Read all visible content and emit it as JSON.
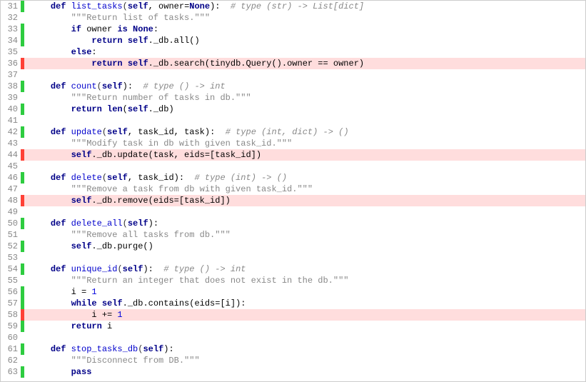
{
  "lines": [
    {
      "n": 31,
      "cov": "hit",
      "code": {
        "segs": [
          {
            "t": "    ",
            "c": ""
          },
          {
            "t": "def",
            "c": "kw"
          },
          {
            "t": " ",
            "c": ""
          },
          {
            "t": "list_tasks",
            "c": "fn"
          },
          {
            "t": "(",
            "c": "op"
          },
          {
            "t": "self",
            "c": "builtin"
          },
          {
            "t": ", owner=",
            "c": ""
          },
          {
            "t": "None",
            "c": "builtin"
          },
          {
            "t": "):  ",
            "c": ""
          },
          {
            "t": "# type (str) -> List[dict]",
            "c": "comment"
          }
        ]
      }
    },
    {
      "n": 32,
      "cov": "",
      "code": {
        "segs": [
          {
            "t": "        ",
            "c": ""
          },
          {
            "t": "\"\"\"Return list of tasks.\"\"\"",
            "c": "str"
          }
        ]
      }
    },
    {
      "n": 33,
      "cov": "hit",
      "code": {
        "segs": [
          {
            "t": "        ",
            "c": ""
          },
          {
            "t": "if",
            "c": "kw"
          },
          {
            "t": " owner ",
            "c": ""
          },
          {
            "t": "is",
            "c": "kw"
          },
          {
            "t": " ",
            "c": ""
          },
          {
            "t": "None",
            "c": "builtin"
          },
          {
            "t": ":",
            "c": ""
          }
        ]
      }
    },
    {
      "n": 34,
      "cov": "hit",
      "code": {
        "segs": [
          {
            "t": "            ",
            "c": ""
          },
          {
            "t": "return",
            "c": "kw"
          },
          {
            "t": " ",
            "c": ""
          },
          {
            "t": "self",
            "c": "builtin"
          },
          {
            "t": "._db.all()",
            "c": ""
          }
        ]
      }
    },
    {
      "n": 35,
      "cov": "",
      "code": {
        "segs": [
          {
            "t": "        ",
            "c": ""
          },
          {
            "t": "else",
            "c": "kw"
          },
          {
            "t": ":",
            "c": ""
          }
        ]
      }
    },
    {
      "n": 36,
      "cov": "miss",
      "code": {
        "segs": [
          {
            "t": "            ",
            "c": ""
          },
          {
            "t": "return",
            "c": "kw"
          },
          {
            "t": " ",
            "c": ""
          },
          {
            "t": "self",
            "c": "builtin"
          },
          {
            "t": "._db.search(tinydb.Query().owner == owner)",
            "c": ""
          }
        ]
      }
    },
    {
      "n": 37,
      "cov": "",
      "code": {
        "segs": [
          {
            "t": "",
            "c": ""
          }
        ]
      }
    },
    {
      "n": 38,
      "cov": "hit",
      "code": {
        "segs": [
          {
            "t": "    ",
            "c": ""
          },
          {
            "t": "def",
            "c": "kw"
          },
          {
            "t": " ",
            "c": ""
          },
          {
            "t": "count",
            "c": "fn"
          },
          {
            "t": "(",
            "c": "op"
          },
          {
            "t": "self",
            "c": "builtin"
          },
          {
            "t": "):  ",
            "c": ""
          },
          {
            "t": "# type () -> int",
            "c": "comment"
          }
        ]
      }
    },
    {
      "n": 39,
      "cov": "",
      "code": {
        "segs": [
          {
            "t": "        ",
            "c": ""
          },
          {
            "t": "\"\"\"Return number of tasks in db.\"\"\"",
            "c": "str"
          }
        ]
      }
    },
    {
      "n": 40,
      "cov": "hit",
      "code": {
        "segs": [
          {
            "t": "        ",
            "c": ""
          },
          {
            "t": "return",
            "c": "kw"
          },
          {
            "t": " ",
            "c": ""
          },
          {
            "t": "len",
            "c": "builtin"
          },
          {
            "t": "(",
            "c": ""
          },
          {
            "t": "self",
            "c": "builtin"
          },
          {
            "t": "._db)",
            "c": ""
          }
        ]
      }
    },
    {
      "n": 41,
      "cov": "",
      "code": {
        "segs": [
          {
            "t": "",
            "c": ""
          }
        ]
      }
    },
    {
      "n": 42,
      "cov": "hit",
      "code": {
        "segs": [
          {
            "t": "    ",
            "c": ""
          },
          {
            "t": "def",
            "c": "kw"
          },
          {
            "t": " ",
            "c": ""
          },
          {
            "t": "update",
            "c": "fn"
          },
          {
            "t": "(",
            "c": "op"
          },
          {
            "t": "self",
            "c": "builtin"
          },
          {
            "t": ", task_id, task):  ",
            "c": ""
          },
          {
            "t": "# type (int, dict) -> ()",
            "c": "comment"
          }
        ]
      }
    },
    {
      "n": 43,
      "cov": "",
      "code": {
        "segs": [
          {
            "t": "        ",
            "c": ""
          },
          {
            "t": "\"\"\"Modify task in db with given task_id.\"\"\"",
            "c": "str"
          }
        ]
      }
    },
    {
      "n": 44,
      "cov": "miss",
      "code": {
        "segs": [
          {
            "t": "        ",
            "c": ""
          },
          {
            "t": "self",
            "c": "builtin"
          },
          {
            "t": "._db.update(task, eids=[task_id])",
            "c": ""
          }
        ]
      }
    },
    {
      "n": 45,
      "cov": "",
      "code": {
        "segs": [
          {
            "t": "",
            "c": ""
          }
        ]
      }
    },
    {
      "n": 46,
      "cov": "hit",
      "code": {
        "segs": [
          {
            "t": "    ",
            "c": ""
          },
          {
            "t": "def",
            "c": "kw"
          },
          {
            "t": " ",
            "c": ""
          },
          {
            "t": "delete",
            "c": "fn"
          },
          {
            "t": "(",
            "c": "op"
          },
          {
            "t": "self",
            "c": "builtin"
          },
          {
            "t": ", task_id):  ",
            "c": ""
          },
          {
            "t": "# type (int) -> ()",
            "c": "comment"
          }
        ]
      }
    },
    {
      "n": 47,
      "cov": "",
      "code": {
        "segs": [
          {
            "t": "        ",
            "c": ""
          },
          {
            "t": "\"\"\"Remove a task from db with given task_id.\"\"\"",
            "c": "str"
          }
        ]
      }
    },
    {
      "n": 48,
      "cov": "miss",
      "code": {
        "segs": [
          {
            "t": "        ",
            "c": ""
          },
          {
            "t": "self",
            "c": "builtin"
          },
          {
            "t": "._db.remove(eids=[task_id])",
            "c": ""
          }
        ]
      }
    },
    {
      "n": 49,
      "cov": "",
      "code": {
        "segs": [
          {
            "t": "",
            "c": ""
          }
        ]
      }
    },
    {
      "n": 50,
      "cov": "hit",
      "code": {
        "segs": [
          {
            "t": "    ",
            "c": ""
          },
          {
            "t": "def",
            "c": "kw"
          },
          {
            "t": " ",
            "c": ""
          },
          {
            "t": "delete_all",
            "c": "fn"
          },
          {
            "t": "(",
            "c": "op"
          },
          {
            "t": "self",
            "c": "builtin"
          },
          {
            "t": "):",
            "c": ""
          }
        ]
      }
    },
    {
      "n": 51,
      "cov": "",
      "code": {
        "segs": [
          {
            "t": "        ",
            "c": ""
          },
          {
            "t": "\"\"\"Remove all tasks from db.\"\"\"",
            "c": "str"
          }
        ]
      }
    },
    {
      "n": 52,
      "cov": "hit",
      "code": {
        "segs": [
          {
            "t": "        ",
            "c": ""
          },
          {
            "t": "self",
            "c": "builtin"
          },
          {
            "t": "._db.purge()",
            "c": ""
          }
        ]
      }
    },
    {
      "n": 53,
      "cov": "",
      "code": {
        "segs": [
          {
            "t": "",
            "c": ""
          }
        ]
      }
    },
    {
      "n": 54,
      "cov": "hit",
      "code": {
        "segs": [
          {
            "t": "    ",
            "c": ""
          },
          {
            "t": "def",
            "c": "kw"
          },
          {
            "t": " ",
            "c": ""
          },
          {
            "t": "unique_id",
            "c": "fn"
          },
          {
            "t": "(",
            "c": "op"
          },
          {
            "t": "self",
            "c": "builtin"
          },
          {
            "t": "):  ",
            "c": ""
          },
          {
            "t": "# type () -> int",
            "c": "comment"
          }
        ]
      }
    },
    {
      "n": 55,
      "cov": "",
      "code": {
        "segs": [
          {
            "t": "        ",
            "c": ""
          },
          {
            "t": "\"\"\"Return an integer that does not exist in the db.\"\"\"",
            "c": "str"
          }
        ]
      }
    },
    {
      "n": 56,
      "cov": "hit",
      "code": {
        "segs": [
          {
            "t": "        i = ",
            "c": ""
          },
          {
            "t": "1",
            "c": "num"
          }
        ]
      }
    },
    {
      "n": 57,
      "cov": "hit",
      "code": {
        "segs": [
          {
            "t": "        ",
            "c": ""
          },
          {
            "t": "while",
            "c": "kw"
          },
          {
            "t": " ",
            "c": ""
          },
          {
            "t": "self",
            "c": "builtin"
          },
          {
            "t": "._db.contains(eids=[i]):",
            "c": ""
          }
        ]
      }
    },
    {
      "n": 58,
      "cov": "miss",
      "code": {
        "segs": [
          {
            "t": "            i += ",
            "c": ""
          },
          {
            "t": "1",
            "c": "num"
          }
        ]
      }
    },
    {
      "n": 59,
      "cov": "hit",
      "code": {
        "segs": [
          {
            "t": "        ",
            "c": ""
          },
          {
            "t": "return",
            "c": "kw"
          },
          {
            "t": " i",
            "c": ""
          }
        ]
      }
    },
    {
      "n": 60,
      "cov": "",
      "code": {
        "segs": [
          {
            "t": "",
            "c": ""
          }
        ]
      }
    },
    {
      "n": 61,
      "cov": "hit",
      "code": {
        "segs": [
          {
            "t": "    ",
            "c": ""
          },
          {
            "t": "def",
            "c": "kw"
          },
          {
            "t": " ",
            "c": ""
          },
          {
            "t": "stop_tasks_db",
            "c": "fn"
          },
          {
            "t": "(",
            "c": "op"
          },
          {
            "t": "self",
            "c": "builtin"
          },
          {
            "t": "):",
            "c": ""
          }
        ]
      }
    },
    {
      "n": 62,
      "cov": "",
      "code": {
        "segs": [
          {
            "t": "        ",
            "c": ""
          },
          {
            "t": "\"\"\"Disconnect from DB.\"\"\"",
            "c": "str"
          }
        ]
      }
    },
    {
      "n": 63,
      "cov": "hit",
      "code": {
        "segs": [
          {
            "t": "        ",
            "c": ""
          },
          {
            "t": "pass",
            "c": "kw"
          }
        ]
      }
    }
  ]
}
